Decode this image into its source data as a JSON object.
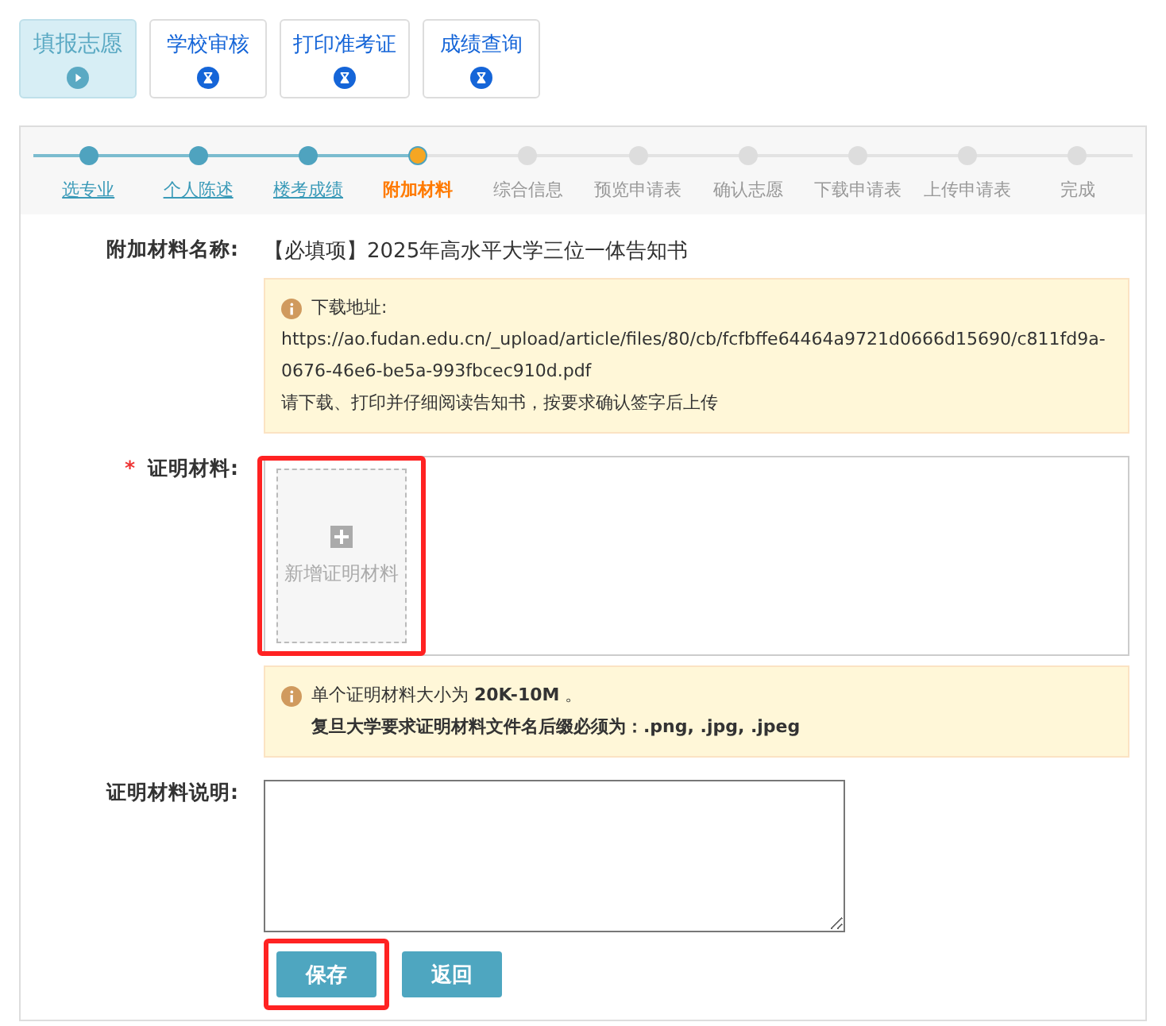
{
  "top_tabs": [
    {
      "label": "填报志愿",
      "selected": true,
      "kind": "play"
    },
    {
      "label": "学校审核",
      "selected": false,
      "kind": "hourglass"
    },
    {
      "label": "打印准考证",
      "selected": false,
      "kind": "hourglass"
    },
    {
      "label": "成绩查询",
      "selected": false,
      "kind": "hourglass"
    }
  ],
  "steps": [
    {
      "label": "选专业",
      "done": true,
      "current": false
    },
    {
      "label": "个人陈述",
      "done": true,
      "current": false
    },
    {
      "label": "楼考成绩",
      "done": true,
      "current": false
    },
    {
      "label": "附加材料",
      "done": false,
      "current": true
    },
    {
      "label": "综合信息",
      "done": false,
      "current": false
    },
    {
      "label": "预览申请表",
      "done": false,
      "current": false
    },
    {
      "label": "确认志愿",
      "done": false,
      "current": false
    },
    {
      "label": "下载申请表",
      "done": false,
      "current": false
    },
    {
      "label": "上传申请表",
      "done": false,
      "current": false
    },
    {
      "label": "完成",
      "done": false,
      "current": false
    }
  ],
  "material_name": {
    "label": "附加材料名称:",
    "value": "【必填项】2025年高水平大学三位一体告知书"
  },
  "download_notice": {
    "title": "下载地址:",
    "url": "https://ao.fudan.edu.cn/_upload/article/files/80/cb/fcfbffe64464a9721d0666d15690/c811fd9a-0676-46e6-be5a-993fbcec910d.pdf",
    "note": "请下载、打印并仔细阅读告知书，按要求确认签字后上传"
  },
  "proof": {
    "required_mark": "*",
    "label": "证明材料:",
    "upload_label": "新增证明材料",
    "highlighted": true
  },
  "size_notice": {
    "line_1": "单个证明材料大小为 **20K-10M** 。",
    "line_2": "复旦大学要求证明材料文件名后缀必须为：.png, .jpg, .jpeg"
  },
  "description": {
    "label": "证明材料说明:"
  },
  "buttons": [
    {
      "label": "保存",
      "highlighted": true
    },
    {
      "label": "返回",
      "highlighted": false
    }
  ]
}
